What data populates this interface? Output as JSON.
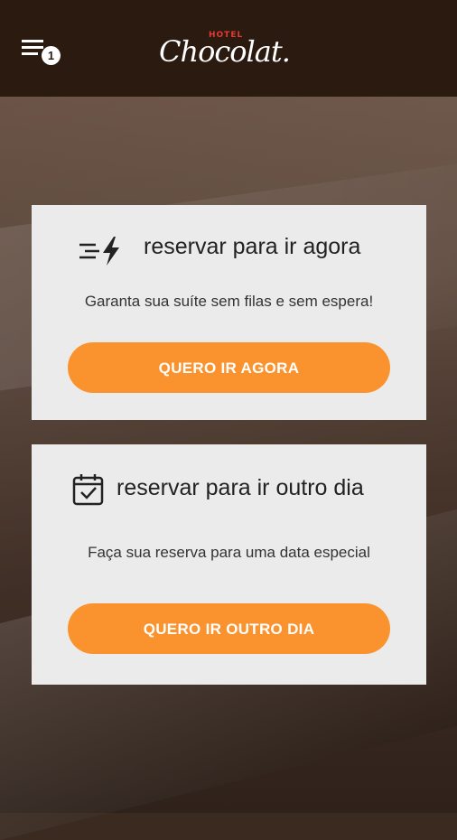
{
  "header": {
    "menu_badge": "1",
    "logo_small": "HOTEL",
    "logo_main": "Chocolat."
  },
  "cards": [
    {
      "title": "reservar para ir agora",
      "subtitle": "Garanta sua suíte sem filas e sem espera!",
      "button": "QUERO IR AGORA",
      "icon": "fast-lightning-icon"
    },
    {
      "title": "reservar para ir outro dia",
      "subtitle": "Faça sua reserva para uma data especial",
      "button": "QUERO IR OUTRO DIA",
      "icon": "calendar-check-icon"
    }
  ],
  "colors": {
    "header_bg": "#2b1a10",
    "card_bg": "#ebebeb",
    "accent": "#fa932e",
    "logo_red": "#e53935"
  }
}
